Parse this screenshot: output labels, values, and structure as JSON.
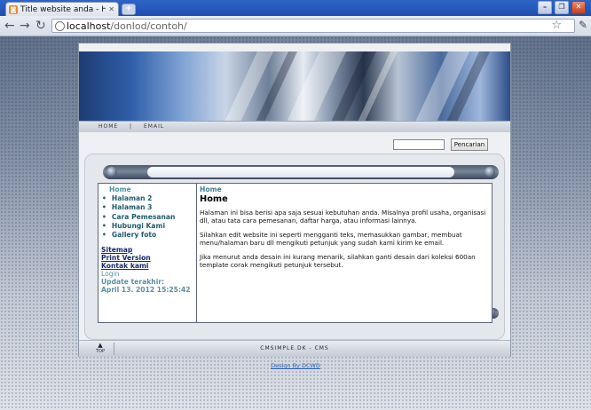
{
  "browser": {
    "tab_title": "Title website anda - Home",
    "tab_favicon": "RSS",
    "newtab_label": "+",
    "url_host": "localhost",
    "url_path": "/donlod/contoh/",
    "window_buttons": [
      "–",
      "❐",
      "✕"
    ],
    "icons": {
      "back": "back-arrow-icon",
      "forward": "forward-arrow-icon",
      "reload": "reload-icon",
      "star": "star-icon",
      "wrench": "wrench-icon"
    }
  },
  "site": {
    "menu": [
      "HOME",
      "|",
      "EMAIL"
    ],
    "search_button": "Pencarian",
    "sidebar": {
      "home": "Home",
      "items": [
        "Halaman 2",
        "Halaman 3",
        "Cara Pemesanan",
        "Hubungi Kami",
        "Gallery foto"
      ],
      "sitemap": "Sitemap",
      "print": "Print Version",
      "contact": "Kontak kami",
      "login": "Login",
      "update_label": "Update terakhir:",
      "update_date": "April 13. 2012 15:25:42"
    },
    "main": {
      "breadcrumb": "Home",
      "title": "Home",
      "paragraphs": [
        "Halaman ini bisa berisi apa saja sesuai kebutuhan anda. Misalnya profil usaha, organisasi dll, atau tata cara pemesanan, daftar harga, atau informasi lainnya.",
        "Silahkan edit website ini seperti mengganti teks, memasukkan gambar, membuat menu/halaman baru dll mengikuti petunjuk yang sudah kami kirim ke email.",
        "Jika menurut anda desain ini kurang menarik, silahkan ganti desain dari koleksi 600an template corak mengikuti petunjuk tersebut."
      ]
    },
    "footer": {
      "top_label": "TOP",
      "credit": "CMSIMPLE.DK - CMS"
    },
    "design_credit": "Design By DCWD"
  }
}
